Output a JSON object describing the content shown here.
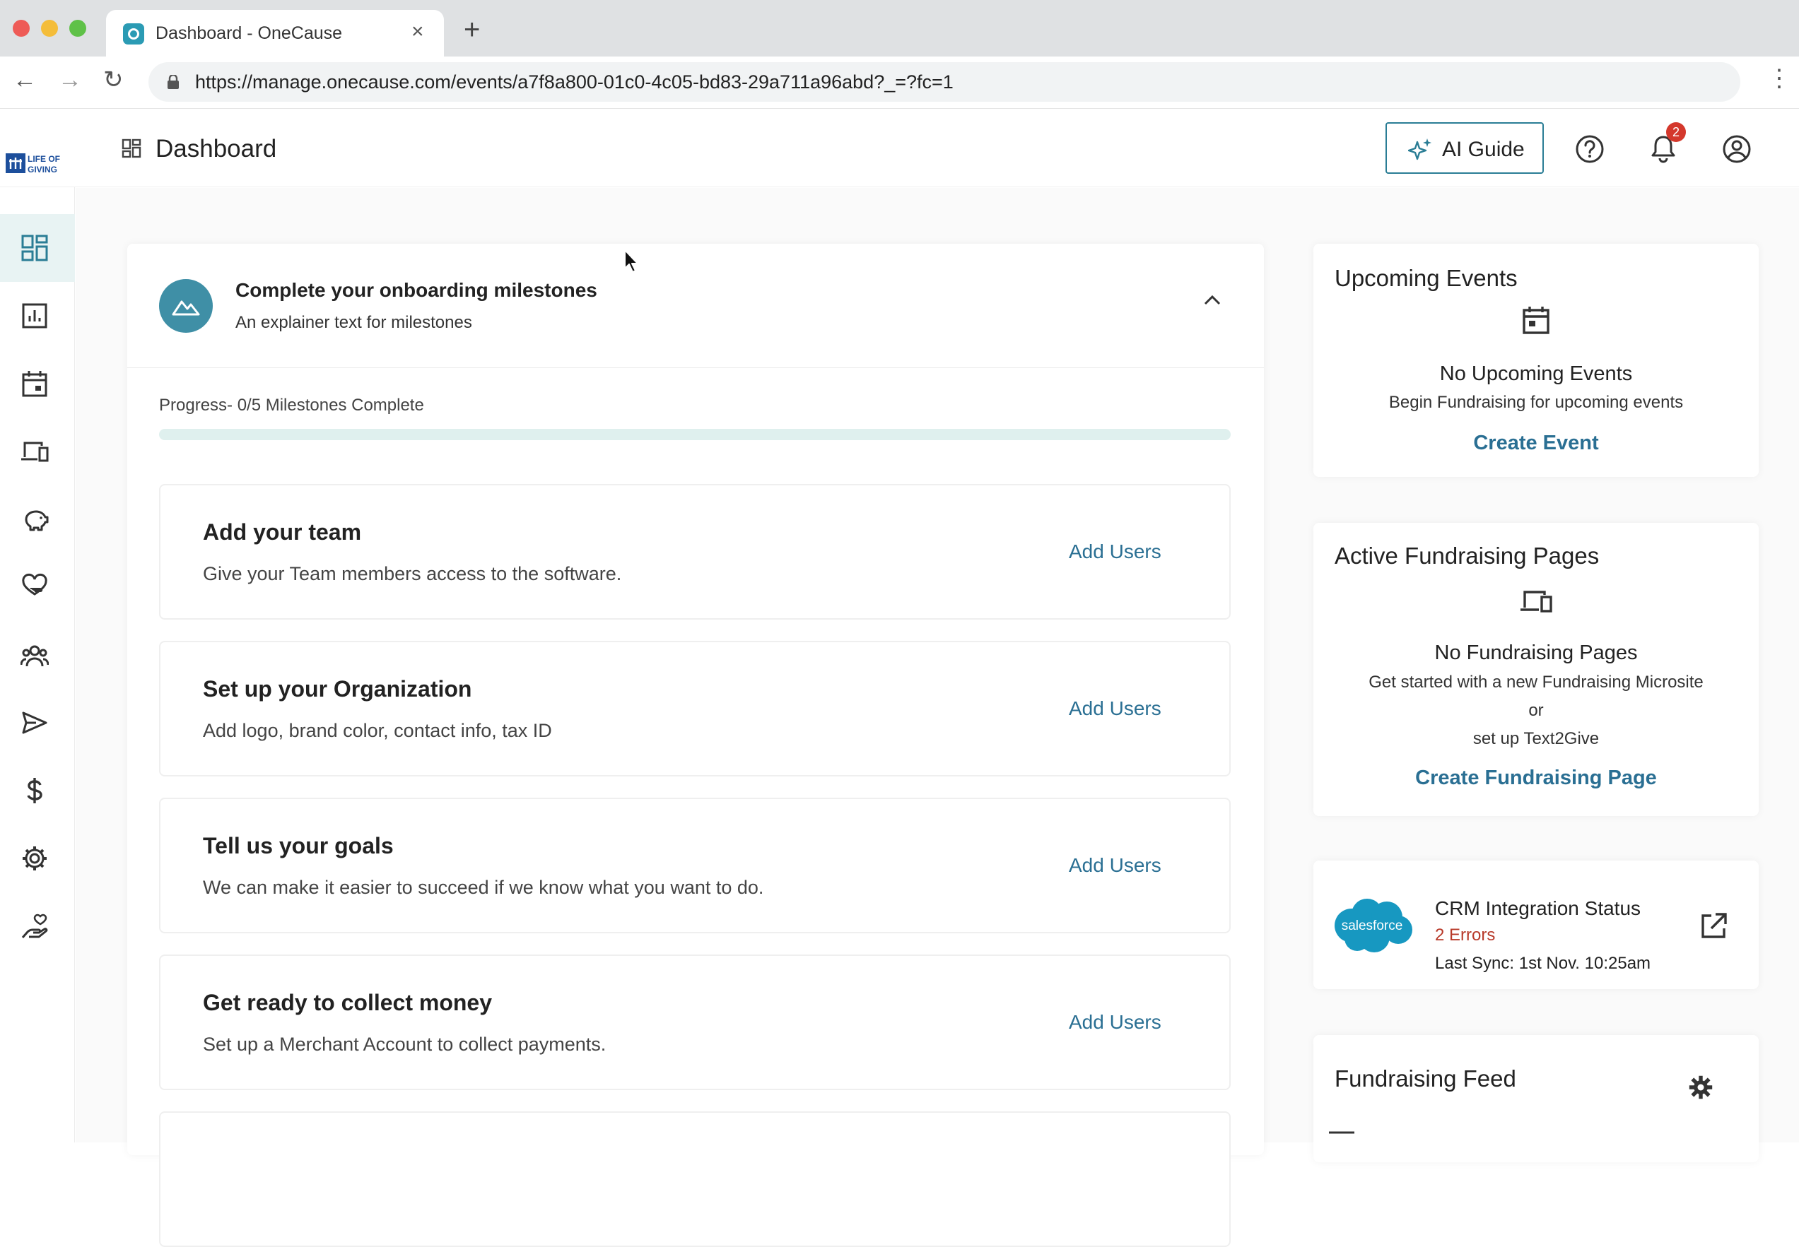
{
  "browser": {
    "tab_title": "Dashboard - OneCause",
    "tab_close": "×",
    "new_tab": "+",
    "url": "https://manage.onecause.com/events/a7f8a800-01c0-4c05-bd83-29a711a96abd?_=?fc=1",
    "back": "←",
    "forward": "→",
    "reload": "↻",
    "menu": "⋮"
  },
  "header": {
    "title": "Dashboard",
    "ai_guide_label": "AI Guide",
    "notification_count": "2",
    "brand_logo_text": "LIFE OF GIVING"
  },
  "sidebar": {
    "items": [
      {
        "icon": "dashboard-icon",
        "active": true
      },
      {
        "icon": "reports-icon",
        "active": false
      },
      {
        "icon": "calendar-event-icon",
        "active": false
      },
      {
        "icon": "devices-icon",
        "active": false
      },
      {
        "icon": "piggy-bank-icon",
        "active": false
      },
      {
        "icon": "heart-hand-icon",
        "active": false
      },
      {
        "icon": "people-icon",
        "active": false
      },
      {
        "icon": "send-icon",
        "active": false
      },
      {
        "icon": "dollar-icon",
        "active": false
      },
      {
        "icon": "settings-icon",
        "active": false
      },
      {
        "icon": "donation-hand-icon",
        "active": false
      }
    ]
  },
  "onboarding": {
    "title": "Complete your onboarding milestones",
    "subtitle": "An explainer text for milestones",
    "progress_label": "Progress- 0/5 Milestones Complete",
    "progress_fraction": 0.0,
    "milestones": [
      {
        "title": "Add your team",
        "desc": "Give your Team members access to the software.",
        "action": "Add Users"
      },
      {
        "title": "Set up your Organization",
        "desc": "Add logo, brand color, contact info, tax ID",
        "action": "Add Users"
      },
      {
        "title": "Tell us your goals",
        "desc": "We can make it easier to succeed if we know what you want to do.",
        "action": "Add Users"
      },
      {
        "title": "Get ready to collect money",
        "desc": "Set up a Merchant Account to collect payments.",
        "action": "Add Users"
      }
    ]
  },
  "upcoming_events": {
    "title": "Upcoming Events",
    "empty_title": "No Upcoming Events",
    "empty_text": "Begin Fundraising for upcoming events",
    "action": "Create Event"
  },
  "fundraising_pages": {
    "title": "Active Fundraising Pages",
    "empty_title": "No Fundraising Pages",
    "line1": "Get started with a new Fundraising Microsite",
    "line2": "or",
    "line3": "set up Text2Give",
    "action": "Create Fundraising Page"
  },
  "crm": {
    "logo_text": "salesforce",
    "title": "CRM Integration Status",
    "errors": "2 Errors",
    "last_sync": "Last Sync: 1st Nov. 10:25am"
  },
  "feed": {
    "title": "Fundraising Feed"
  },
  "colors": {
    "accent": "#2a7d95",
    "link": "#2a6f93",
    "error": "#b83a2a",
    "badge": "#d4382c",
    "progress_track": "#dff0ee",
    "salesforce": "#1798c1"
  }
}
